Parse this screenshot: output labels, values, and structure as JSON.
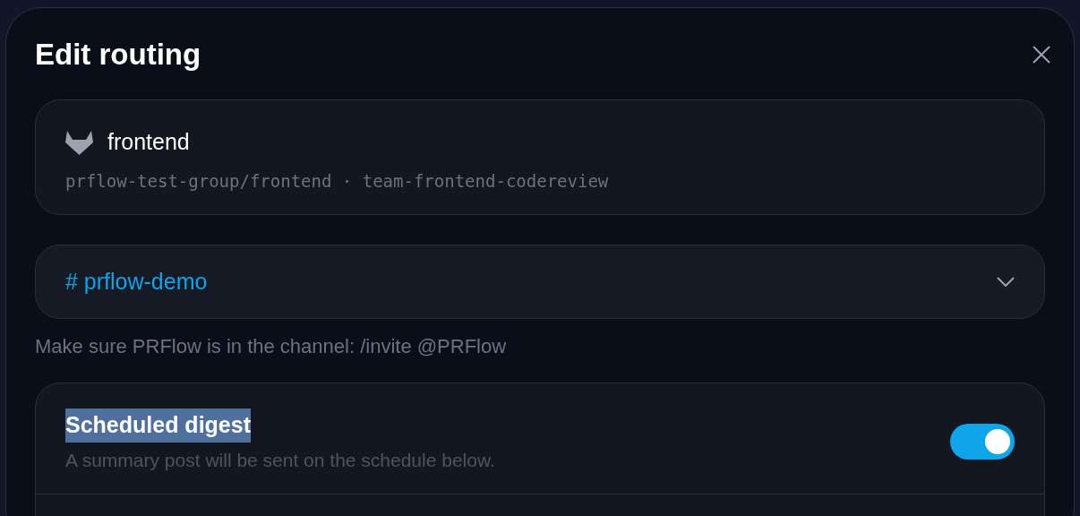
{
  "dialog": {
    "title": "Edit routing"
  },
  "repo": {
    "name": "frontend",
    "path": "prflow-test-group/frontend · team-frontend-codereview"
  },
  "channel_select": {
    "value": "# prflow-demo"
  },
  "hint": "Make sure PRFlow is in the channel: /invite @PRFlow",
  "digest": {
    "title": "Scheduled digest",
    "title_highlighted": true,
    "description": "A summary post will be sent on the schedule below.",
    "on": true
  }
}
